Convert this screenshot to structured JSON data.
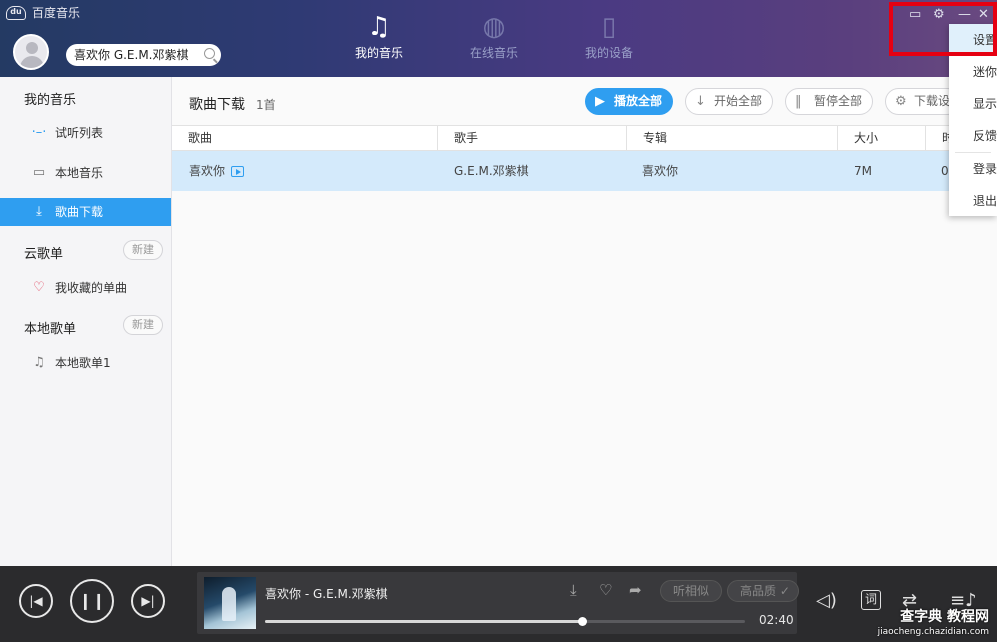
{
  "app": {
    "title": "百度音乐",
    "logo_text": "du"
  },
  "header": {
    "search_value": "喜欢你 G.E.M.邓紫棋",
    "tabs": [
      {
        "label": "我的音乐",
        "icon": "music-note-icon",
        "active": true
      },
      {
        "label": "在线音乐",
        "icon": "globe-icon",
        "active": false
      },
      {
        "label": "我的设备",
        "icon": "device-icon",
        "active": false
      }
    ]
  },
  "settings_menu": {
    "items": [
      "设置",
      "迷你",
      "显示",
      "反馈",
      "登录",
      "退出"
    ],
    "active_index": 0
  },
  "sidebar": {
    "my_music_title": "我的音乐",
    "my_music_items": [
      {
        "label": "试听列表",
        "icon": "dots-list-icon"
      },
      {
        "label": "本地音乐",
        "icon": "monitor-icon"
      },
      {
        "label": "歌曲下载",
        "icon": "download-icon",
        "active": true
      }
    ],
    "cloud_title": "云歌单",
    "cloud_new": "新建",
    "cloud_items": [
      {
        "label": "我收藏的单曲",
        "icon": "heart-icon"
      }
    ],
    "local_title": "本地歌单",
    "local_new": "新建",
    "local_items": [
      {
        "label": "本地歌单1",
        "icon": "music-note-icon"
      }
    ]
  },
  "main": {
    "title": "歌曲下载",
    "count": "1首",
    "toolbar": {
      "play_all": "播放全部",
      "start_all": "开始全部",
      "pause_all": "暂停全部",
      "download_settings": "下载设"
    },
    "columns": [
      "歌曲",
      "歌手",
      "专辑",
      "大小",
      "时"
    ],
    "rows": [
      {
        "song": "喜欢你",
        "artist": "G.E.M.邓紫棋",
        "album": "喜欢你",
        "size": "7M",
        "time": "0:"
      }
    ]
  },
  "player": {
    "now_playing": "喜欢你 - G.E.M.邓紫棋",
    "similar": "听相似",
    "quality": "高品质",
    "time": "02:40",
    "progress": 0.66,
    "lyric_label": "词"
  },
  "watermark": {
    "main": "查字典 教程网",
    "sub": "jiaocheng.chazidian.com"
  },
  "colors": {
    "accent": "#2f9ef0",
    "highlight": "#e60012",
    "player_bg": "#2b2b2d"
  }
}
